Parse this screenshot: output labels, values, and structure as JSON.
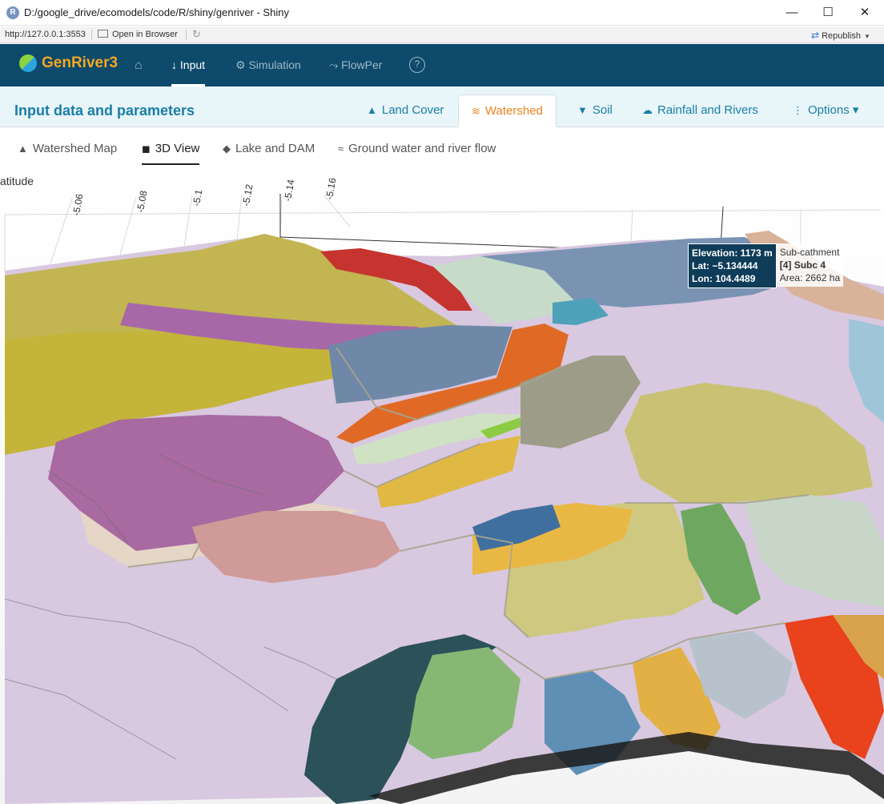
{
  "window": {
    "title": "D:/google_drive/ecomodels/code/R/shiny/genriver - Shiny",
    "minimize": "—",
    "maximize": "☐",
    "close": "✕"
  },
  "addressbar": {
    "url": "http://127.0.0.1:3553",
    "open_in_browser": "Open in Browser",
    "republish": "Republish"
  },
  "navbar": {
    "brand": "GenRiver3",
    "home_icon": "⌂",
    "items": [
      {
        "label": "Input",
        "icon": "↓"
      },
      {
        "label": "Simulation",
        "icon": "⚙"
      },
      {
        "label": "FlowPer",
        "icon": "⤳"
      }
    ],
    "help_icon": "?"
  },
  "subheader": {
    "title": "Input data and parameters",
    "tabs": [
      {
        "label": "Land Cover",
        "icon": "▲"
      },
      {
        "label": "Watershed",
        "icon": "≋"
      },
      {
        "label": "Soil",
        "icon": "▼"
      },
      {
        "label": "Rainfall and Rivers",
        "icon": "☁"
      },
      {
        "label": "Options",
        "icon": "⋮",
        "caret": "▾"
      }
    ]
  },
  "view_tabs": [
    {
      "label": "Watershed Map",
      "icon": "▲"
    },
    {
      "label": "3D View",
      "icon": "◼"
    },
    {
      "label": "Lake and DAM",
      "icon": "◆"
    },
    {
      "label": "Ground water and river flow",
      "icon": "≈"
    }
  ],
  "plot": {
    "axis_title": "atitude",
    "lat_ticks": [
      "-5.06",
      "-5.08",
      "-5.1",
      "-5.12",
      "-5.14",
      "-5.16"
    ],
    "tooltip": {
      "elevation": "Elevation: 1173 m",
      "lat": "Lat: −5.134444",
      "lon": "Lon: 104.4489",
      "layer": "Sub-cathment",
      "subc": "[4] Subc 4",
      "area": "Area: 2662 ha"
    }
  },
  "colors": {
    "navbar": "#0d4a6b",
    "brand": "#f5a623",
    "accent_blue": "#1a7ea6",
    "accent_orange": "#f0821e"
  }
}
